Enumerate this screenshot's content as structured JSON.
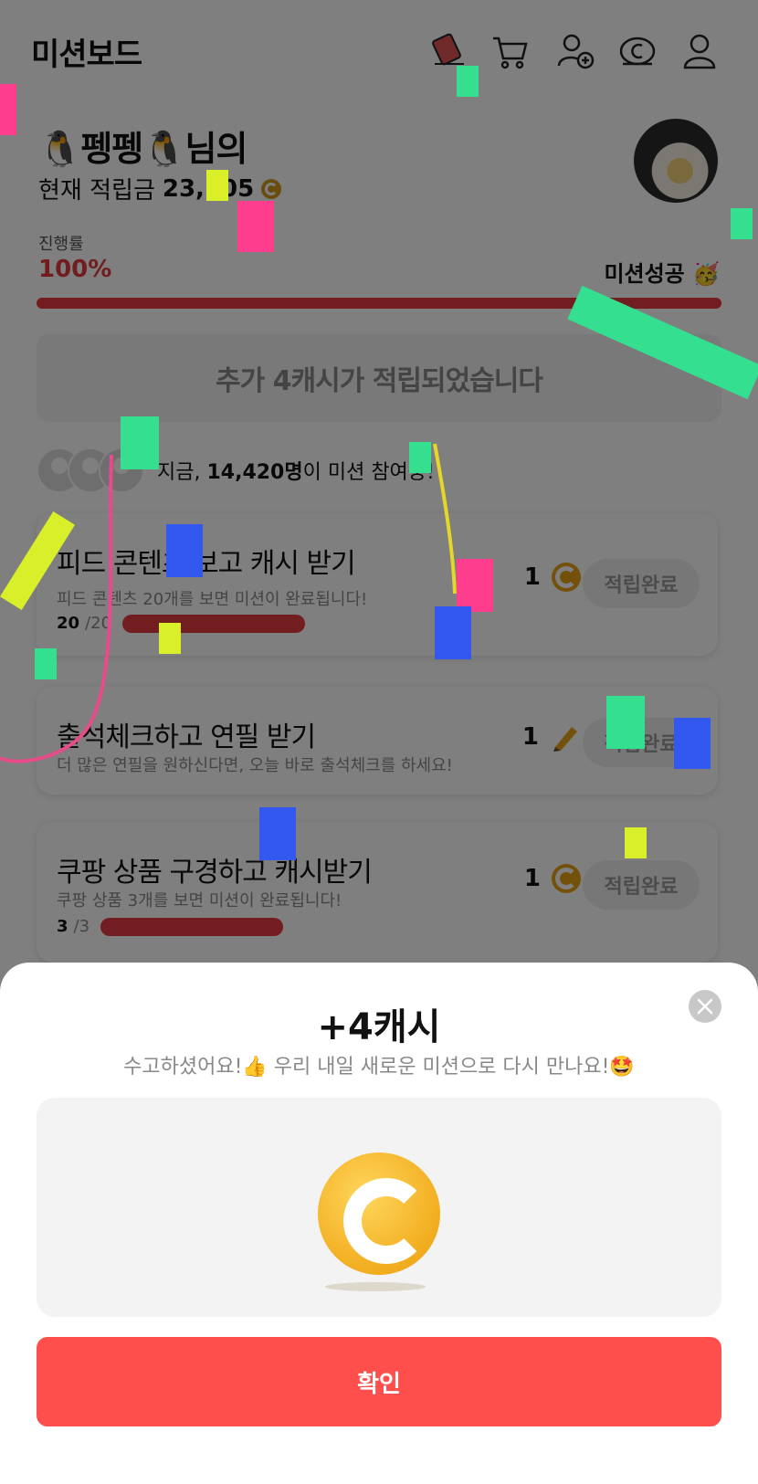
{
  "header": {
    "title": "미션보드"
  },
  "profile": {
    "nickname": "🐧펭펭🐧님의",
    "points_label": "현재 적립금",
    "points_value": "23,105"
  },
  "progress": {
    "label": "진행률",
    "value": "100%",
    "percent": 100,
    "status": "미션성공 🥳"
  },
  "notice": "추가 4캐시가 적립되었습니다",
  "participants": {
    "prefix": "지금, ",
    "count": "14,420명",
    "suffix": "이 미션 참여중!"
  },
  "missions": [
    {
      "title": "피드 콘텐츠 보고 캐시 받기",
      "desc": "피드 콘텐츠 20개를 보면 미션이 완료됩니다!",
      "done": "20",
      "total": "/20",
      "reward": "1",
      "reward_icon": "coin-icon",
      "button": "적립완료"
    },
    {
      "title": "출석체크하고 연필 받기",
      "desc": "더 많은 연필을 원하신다면, 오늘 바로 출석체크를 하세요!",
      "reward": "1",
      "reward_icon": "pencil-icon",
      "button": "적립완료"
    },
    {
      "title": "쿠팡 상품 구경하고 캐시받기",
      "desc": "쿠팡 상품 3개를 보면 미션이 완료됩니다!",
      "done": "3",
      "total": "/3",
      "reward": "1",
      "reward_icon": "coin-icon",
      "button": "적립완료"
    }
  ],
  "sheet": {
    "title": "+4캐시",
    "subtitle": "수고하셨어요!👍 우리 내일 새로운 미션으로 다시 만나요!🤩",
    "confirm": "확인"
  },
  "colors": {
    "accent": "#ff4f4d",
    "progress": "#e53b40",
    "coin": "#f2ad1f"
  }
}
